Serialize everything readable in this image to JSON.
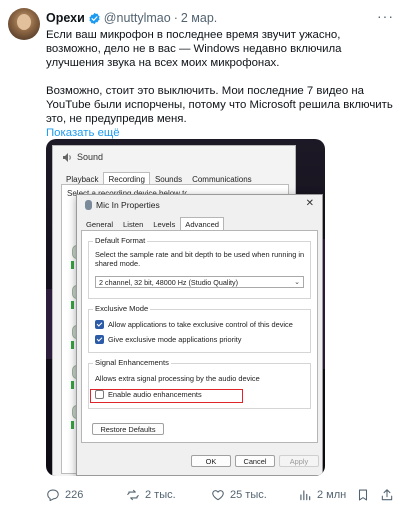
{
  "tweet": {
    "author": "Орехи",
    "handle": "@nuttylmao",
    "separator": "·",
    "date": "2 мар.",
    "paragraph1": "Если ваш микрофон в последнее время звучит ужасно, возможно, дело не в вас — Windows недавно включила улучшения звука на всех моих микрофонах.",
    "paragraph2": "Возможно, стоит это выключить. Мои последние 7 видео на YouTube были испорчены, потому что Microsoft решила включить это, не предупредив меня.",
    "show_more": "Показать ещё"
  },
  "sound_window": {
    "title": "Sound",
    "tabs": [
      "Playback",
      "Recording",
      "Sounds",
      "Communications"
    ],
    "selected_tab": "Recording",
    "hint": "Select a recording device below to modify its settings:"
  },
  "mic_dialog": {
    "title": "Mic In Properties",
    "close": "✕",
    "tabs": [
      "General",
      "Listen",
      "Levels",
      "Advanced"
    ],
    "selected_tab": "Advanced",
    "default_format": {
      "title": "Default Format",
      "description": "Select the sample rate and bit depth to be used when running in shared mode.",
      "selected_value": "2 channel, 32 bit, 48000 Hz (Studio Quality)"
    },
    "exclusive_mode": {
      "title": "Exclusive Mode",
      "allow_exclusive": "Allow applications to take exclusive control of this device",
      "allow_exclusive_checked": true,
      "give_priority": "Give exclusive mode applications priority",
      "give_priority_checked": true
    },
    "signal_enhancements": {
      "title": "Signal Enhancements",
      "description": "Allows extra signal processing by the audio device",
      "enable_label": "Enable audio enhancements",
      "enable_checked": false
    },
    "restore_defaults": "Restore Defaults",
    "ok": "OK",
    "cancel": "Cancel",
    "apply": "Apply"
  },
  "actions": {
    "replies": "226",
    "reposts": "2 тыс.",
    "likes": "25 тыс.",
    "views": "2 млн"
  },
  "colors": {
    "accent": "#1d9bf0",
    "highlight": "#e0242b",
    "muted": "#536471"
  }
}
